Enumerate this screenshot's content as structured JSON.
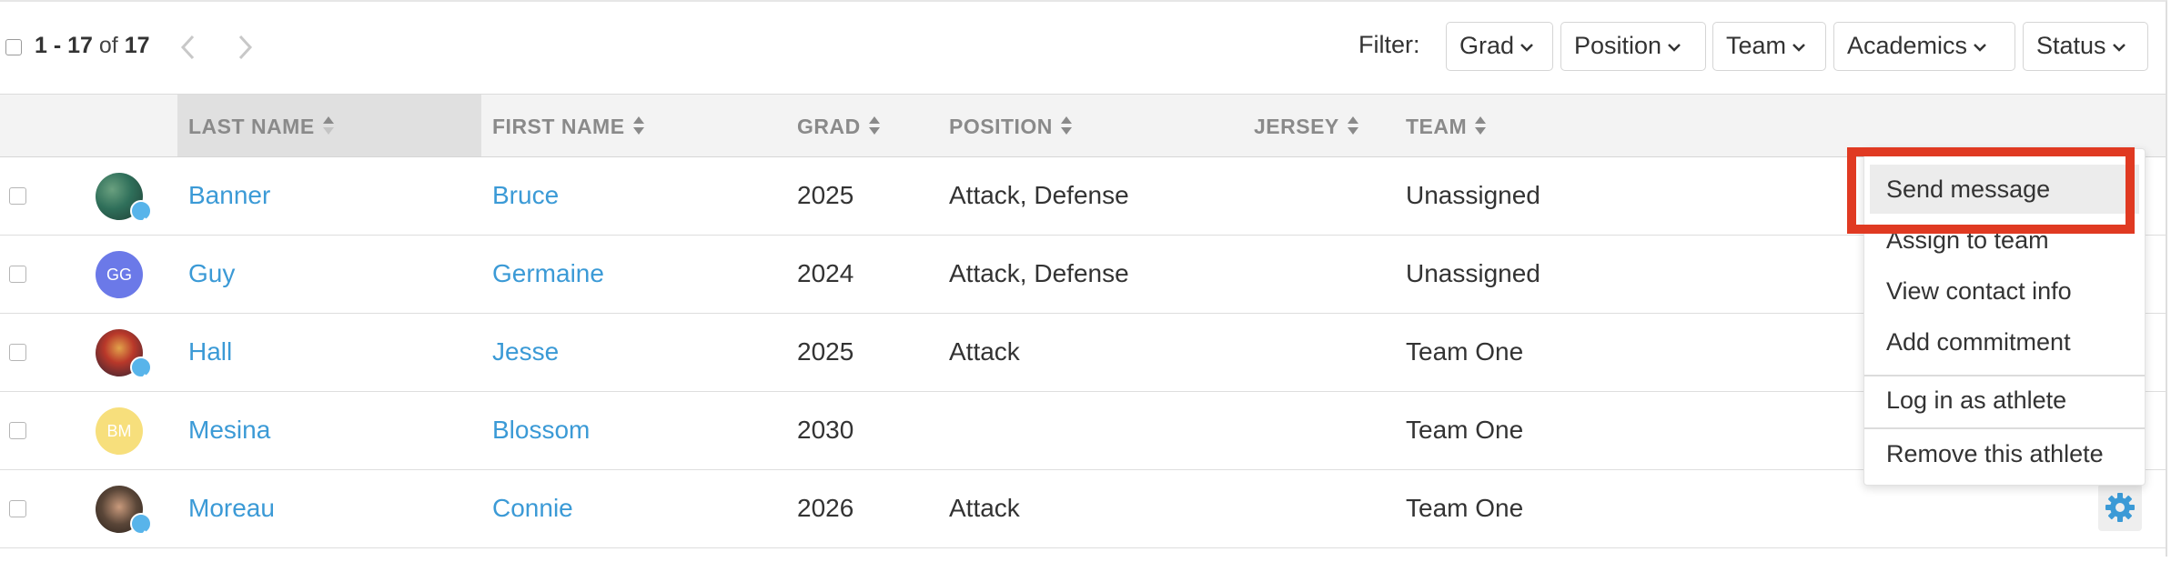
{
  "pager": {
    "range": "1 - 17",
    "of": "of",
    "total": "17"
  },
  "filter": {
    "label": "Filter:",
    "buttons": [
      "Grad",
      "Position",
      "Team",
      "Academics",
      "Status"
    ]
  },
  "columns": {
    "last_name": "LAST NAME",
    "first_name": "FIRST NAME",
    "grad": "GRAD",
    "position": "POSITION",
    "jersey": "JERSEY",
    "team": "TEAM"
  },
  "rows": [
    {
      "last": "Banner",
      "first": "Bruce",
      "grad": "2025",
      "position": "Attack, Defense",
      "jersey": "",
      "team": "Unassigned",
      "avatar": "photo",
      "initials": "",
      "avatar_color": "#2f6f5a",
      "verified": true
    },
    {
      "last": "Guy",
      "first": "Germaine",
      "grad": "2024",
      "position": "Attack, Defense",
      "jersey": "",
      "team": "Unassigned",
      "avatar": "initials",
      "initials": "GG",
      "avatar_color": "#6b79e8",
      "verified": false
    },
    {
      "last": "Hall",
      "first": "Jesse",
      "grad": "2025",
      "position": "Attack",
      "jersey": "",
      "team": "Team One",
      "avatar": "photo",
      "initials": "",
      "avatar_color": "#7a2b1e",
      "verified": true
    },
    {
      "last": "Mesina",
      "first": "Blossom",
      "grad": "2030",
      "position": "",
      "jersey": "",
      "team": "Team One",
      "avatar": "initials",
      "initials": "BM",
      "avatar_color": "#f7df7c",
      "verified": false
    },
    {
      "last": "Moreau",
      "first": "Connie",
      "grad": "2026",
      "position": "Attack",
      "jersey": "",
      "team": "Team One",
      "avatar": "photo",
      "initials": "",
      "avatar_color": "#5a4638",
      "verified": true
    }
  ],
  "menu": {
    "items": [
      "Send message",
      "Assign to team",
      "View contact info",
      "Add commitment",
      "Log in as athlete",
      "Remove this athlete"
    ],
    "highlighted": "Send message"
  },
  "colors": {
    "link": "#3b9ad6",
    "callout": "#e03a22",
    "verified": "#58b4ea",
    "gear": "#3b9ad6"
  }
}
